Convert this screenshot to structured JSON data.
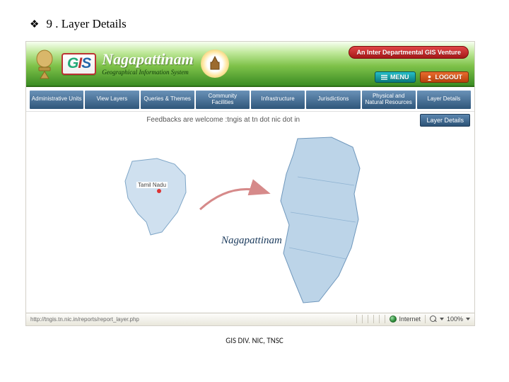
{
  "heading": "9 . Layer Details",
  "banner": {
    "brand_g": "G",
    "brand_i": "I",
    "brand_s": "S",
    "title": "Nagapattinam",
    "subtitle": "Geographical Information System",
    "venture": "An Inter Departmental GIS Venture",
    "menu": "MENU",
    "logout": "LOGOUT"
  },
  "nav": [
    "Administrative Units",
    "View Layers",
    "Queries & Themes",
    "Community Facilities",
    "Infrastructure",
    "Jurisdictions",
    "Physical and Natural Resources",
    "Layer Details"
  ],
  "feedback": "Feedbacks are welcome :tngis at tn dot nic dot in",
  "layer_button": "Layer Details",
  "map": {
    "tn_label": "Tamil Nadu",
    "naga_label": "Nagapattinam"
  },
  "status": {
    "url": "http://tngis.tn.nic.in/reports/report_layer.php",
    "zone": "Internet",
    "zoom": "100%"
  },
  "footer": "GIS DIV. NIC, TNSC"
}
